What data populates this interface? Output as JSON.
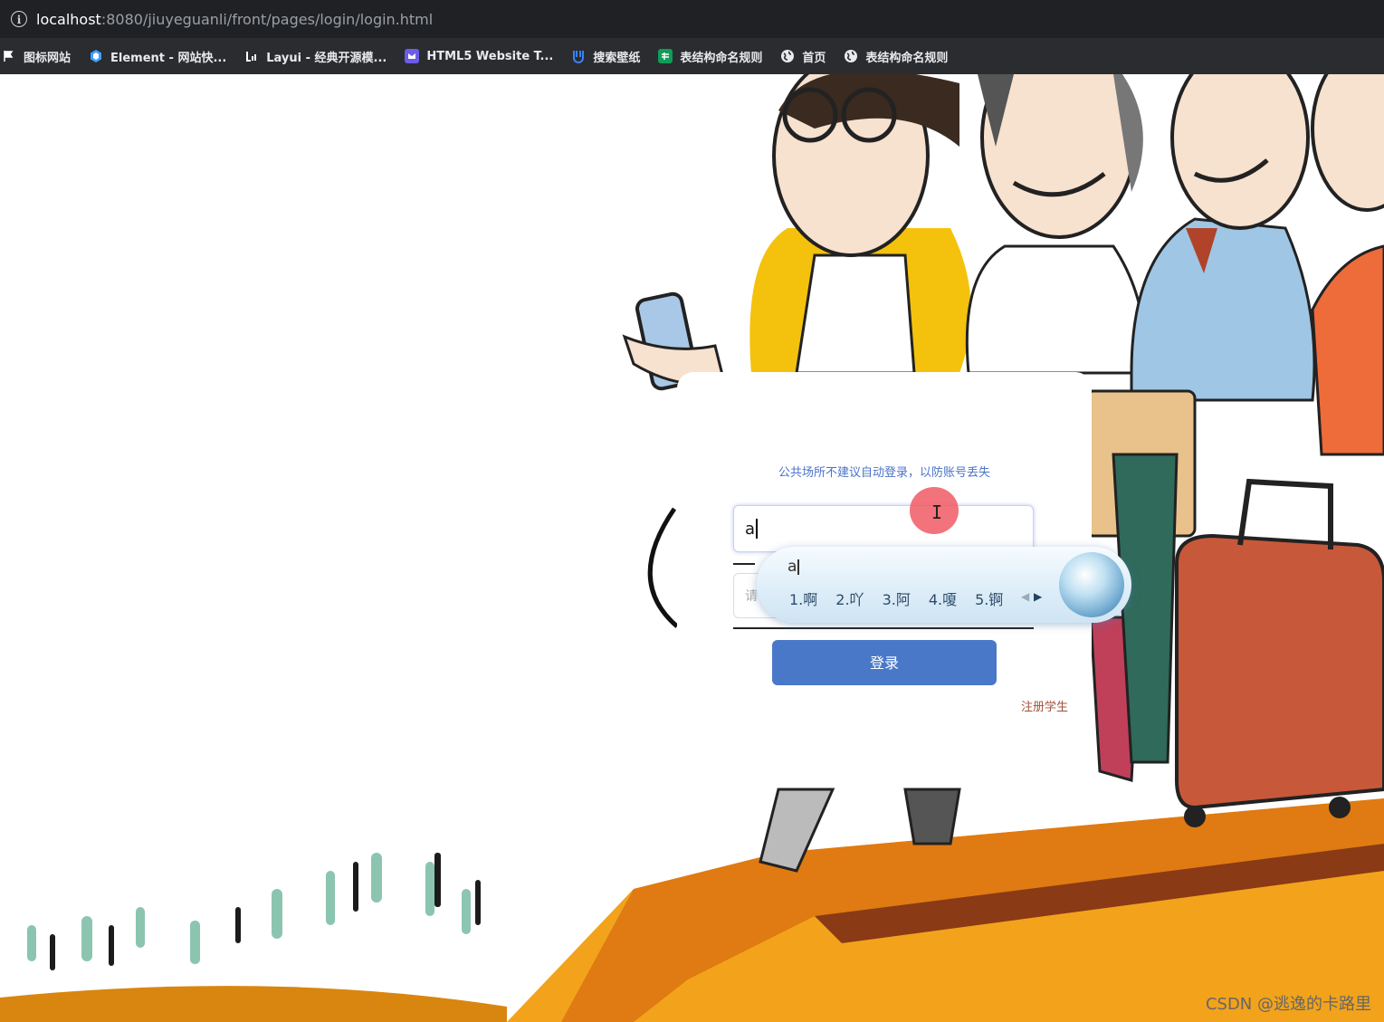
{
  "browser": {
    "url_host": "localhost",
    "url_rest": ":8080/jiuyeguanli/front/pages/login/login.html",
    "bookmarks": [
      {
        "label": "图标网站",
        "icon": "bookmark-flag-icon"
      },
      {
        "label": "Element - 网站快...",
        "icon": "element-logo-icon",
        "color": "#409eff"
      },
      {
        "label": "Layui - 经典开源模...",
        "icon": "layui-logo-icon"
      },
      {
        "label": "HTML5 Website T...",
        "icon": "html5-template-icon",
        "color": "#6c5ce7"
      },
      {
        "label": "搜索壁纸",
        "icon": "wallpaper-search-icon",
        "color": "#3b82f6"
      },
      {
        "label": "表结构命名规则",
        "icon": "spreadsheet-icon",
        "color": "#0f9d58"
      },
      {
        "label": "首页",
        "icon": "globe-icon"
      },
      {
        "label": "表结构命名规则",
        "icon": "globe-icon"
      }
    ]
  },
  "login": {
    "notice": "公共场所不建议自动登录，以防账号丢失",
    "username_value": "a",
    "password_hint": "请",
    "login_button": "登录",
    "register_link": "注册学生"
  },
  "ime": {
    "composition": "a",
    "candidates": [
      "1.啊",
      "2.吖",
      "3.阿",
      "4.嗄",
      "5.锕"
    ],
    "prev_arrow": "◀",
    "next_arrow": "▶"
  },
  "watermark": "CSDN @逃逸的卡路里",
  "colors": {
    "button": "#4a78c9",
    "notice_text": "#4b73c7",
    "register_text": "#a0523a",
    "click_marker": "#f05a64"
  }
}
